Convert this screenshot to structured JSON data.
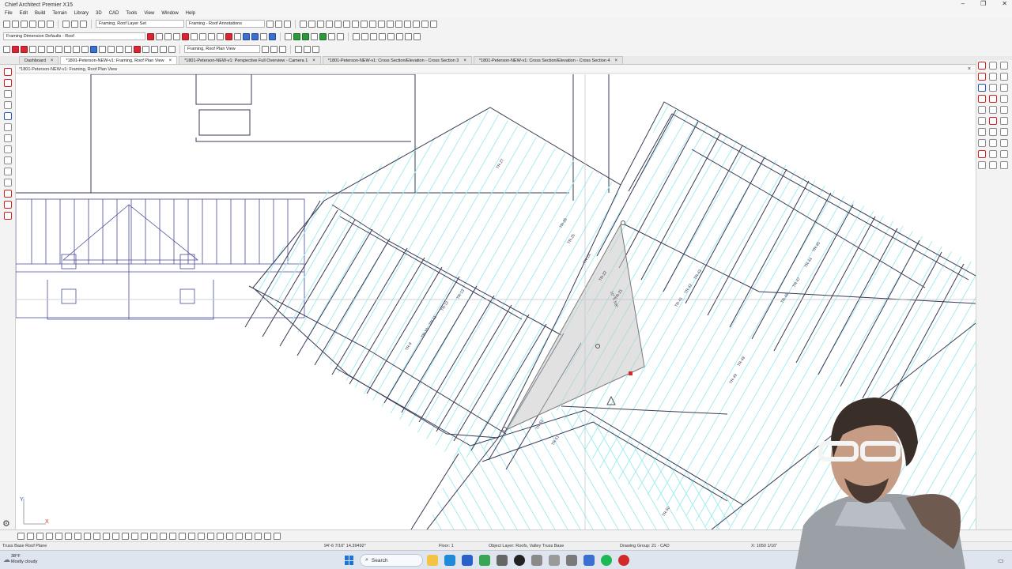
{
  "app": {
    "title": "Chief Architect Premier X15",
    "window_controls": [
      "–",
      "❐",
      "✕"
    ]
  },
  "menu": [
    "File",
    "Edit",
    "Build",
    "Terrain",
    "Library",
    "3D",
    "CAD",
    "Tools",
    "View",
    "Window",
    "Help"
  ],
  "toolbar": {
    "layer_set": "Framing, Roof Layer Set",
    "annotation_set": "Framing - Roof Annotations",
    "dimension_defaults": "Framing Dimension Defaults - Roof",
    "plan_view": "Framing, Roof Plan View"
  },
  "tabs": [
    {
      "label": "Dashboard",
      "active": false
    },
    {
      "label": "*1801-Peterson-NEW-v1: Framing, Roof Plan View",
      "active": true
    },
    {
      "label": "*1801-Peterson-NEW-v1: Perspective Full Overview - Camera 1",
      "active": false
    },
    {
      "label": "*1801-Peterson-NEW-v1: Cross Section/Elevation - Cross Section 3",
      "active": false
    },
    {
      "label": "*1801-Peterson-NEW-v1: Cross Section/Elevation - Cross Section 4",
      "active": false
    }
  ],
  "view_title": "*1801-Peterson-NEW-v1: Framing, Roof Plan View",
  "canvas": {
    "truss_labels": [
      "TR-27",
      "TR-26",
      "TR-25",
      "TR-24",
      "TR-22",
      "TR-21",
      "TR-13",
      "TR-12",
      "TR-11",
      "TR-10",
      "TR-9",
      "TR-43",
      "TR-42",
      "TR-41",
      "TR-45",
      "TR-44",
      "TR-47",
      "TR-46",
      "TR-48",
      "TR-49",
      "TR-52",
      "TR-51",
      "TR-50"
    ],
    "plane_label": "10\" 5 5/8\"",
    "axis_x": "X",
    "axis_y": "Y"
  },
  "status": {
    "object": "Truss Base Roof Plane",
    "coords": "94'-6 7/16\" 14.39492°",
    "floor": "Floor: 1",
    "object_layer": "Object Layer: Roofs, Valley Truss Base",
    "drawing_group": "Drawing Group: 21 - CAD",
    "scale": "X: 1050 1/16\""
  },
  "taskbar": {
    "weather_temp": "38°F",
    "weather_desc": "Mostly cloudy",
    "search_label": "Search"
  },
  "colors": {
    "drawing_line": "#3a3a55",
    "truss_lines": "#4a4a9a",
    "cyan_hatch": "#a6ecef",
    "selected_plane": "#c8c8c8",
    "accent_red": "#d22a2a"
  }
}
